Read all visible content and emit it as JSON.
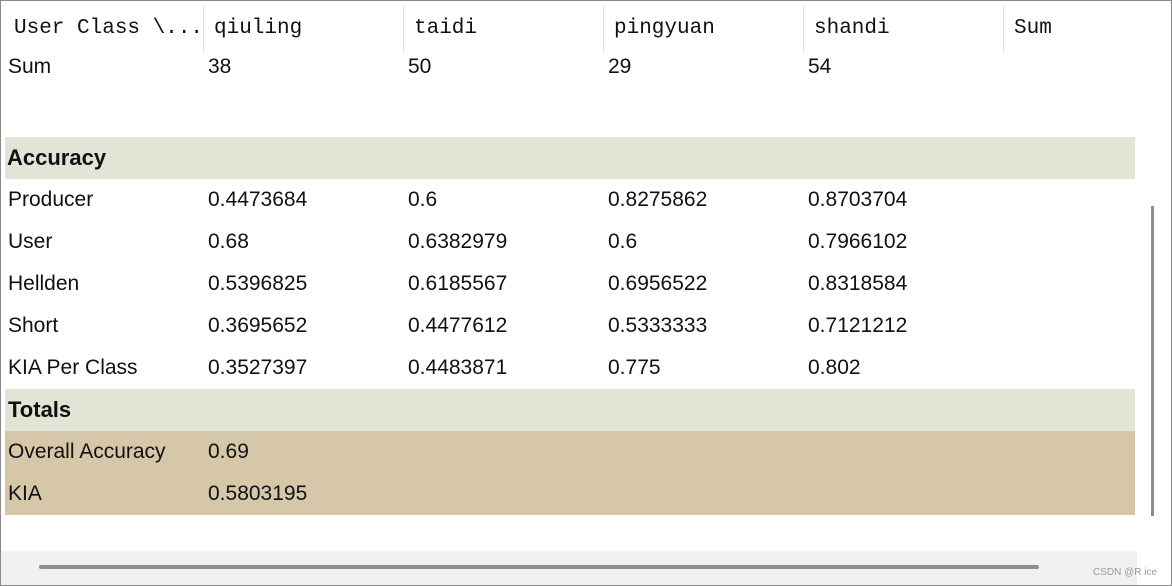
{
  "header": {
    "columns": [
      "User Class \\...",
      "qiuling",
      "taidi",
      "pingyuan",
      "shandi",
      "Sum"
    ]
  },
  "sum_row": {
    "label": "Sum",
    "values": [
      "38",
      "50",
      "29",
      "54"
    ]
  },
  "accuracy": {
    "title": "Accuracy",
    "rows": [
      {
        "label": "Producer",
        "values": [
          "0.4473684",
          "0.6",
          "0.8275862",
          "0.8703704"
        ]
      },
      {
        "label": "User",
        "values": [
          "0.68",
          "0.6382979",
          "0.6",
          "0.7966102"
        ]
      },
      {
        "label": "Hellden",
        "values": [
          "0.5396825",
          "0.6185567",
          "0.6956522",
          "0.8318584"
        ]
      },
      {
        "label": "Short",
        "values": [
          "0.3695652",
          "0.4477612",
          "0.5333333",
          "0.7121212"
        ]
      },
      {
        "label": "KIA Per Class",
        "values": [
          "0.3527397",
          "0.4483871",
          "0.775",
          "0.802"
        ]
      }
    ]
  },
  "totals": {
    "title": "Totals",
    "rows": [
      {
        "label": "Overall Accuracy",
        "value": "0.69"
      },
      {
        "label": "KIA",
        "value": "0.5803195"
      }
    ]
  },
  "watermark": "CSDN @R ice"
}
